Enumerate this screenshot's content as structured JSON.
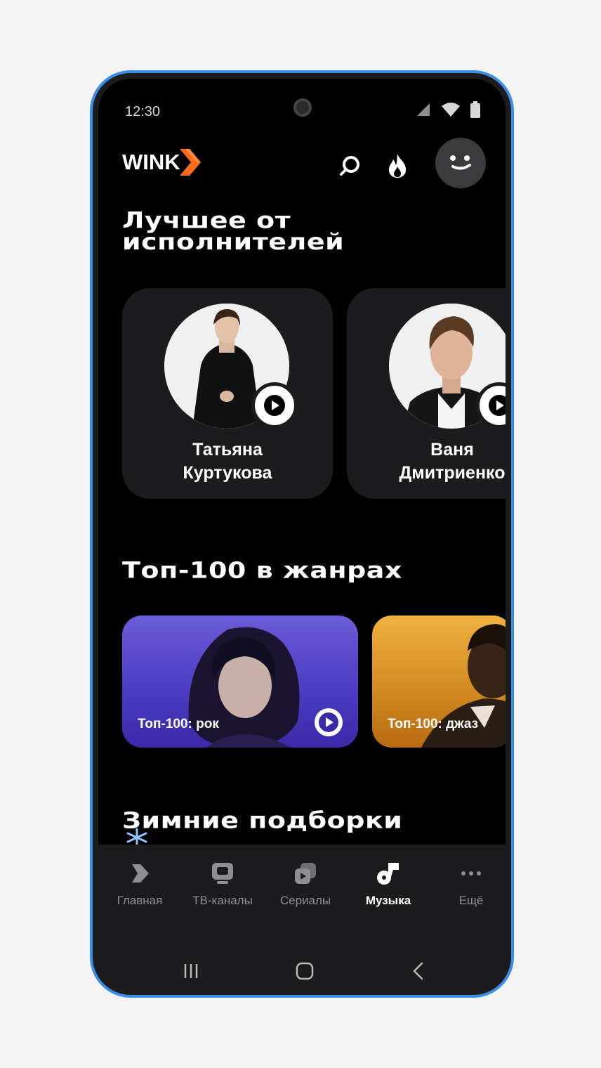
{
  "status_bar": {
    "time": "12:30"
  },
  "header": {
    "logo": "WINK"
  },
  "sections": {
    "artists_title": [
      "Лучшее от",
      "исполнителей"
    ],
    "genres_title": "Топ-100 в жанрах",
    "winter_title": "Зимние подборки"
  },
  "artists": [
    {
      "name_line1": "Татьяна",
      "name_line2": "Куртукова"
    },
    {
      "name_line1": "Ваня",
      "name_line2": "Дмитриенко"
    }
  ],
  "genres": [
    {
      "label": "Топ-100: рок"
    },
    {
      "label": "Топ-100: джаз"
    }
  ],
  "nav": [
    {
      "label": "Главная",
      "icon": "home-icon"
    },
    {
      "label": "ТВ-каналы",
      "icon": "tv-icon"
    },
    {
      "label": "Сериалы",
      "icon": "series-icon"
    },
    {
      "label": "Музыка",
      "icon": "music-icon",
      "active": true
    },
    {
      "label": "Ещё",
      "icon": "more-icon"
    }
  ],
  "colors": {
    "accent_orange": "#ff6b1a",
    "frame_blue": "#3a8ee6",
    "rock_gradient": [
      "#5b4bd8",
      "#3a2aa8"
    ],
    "jazz_gradient": [
      "#e09a2c",
      "#b86a10"
    ]
  }
}
